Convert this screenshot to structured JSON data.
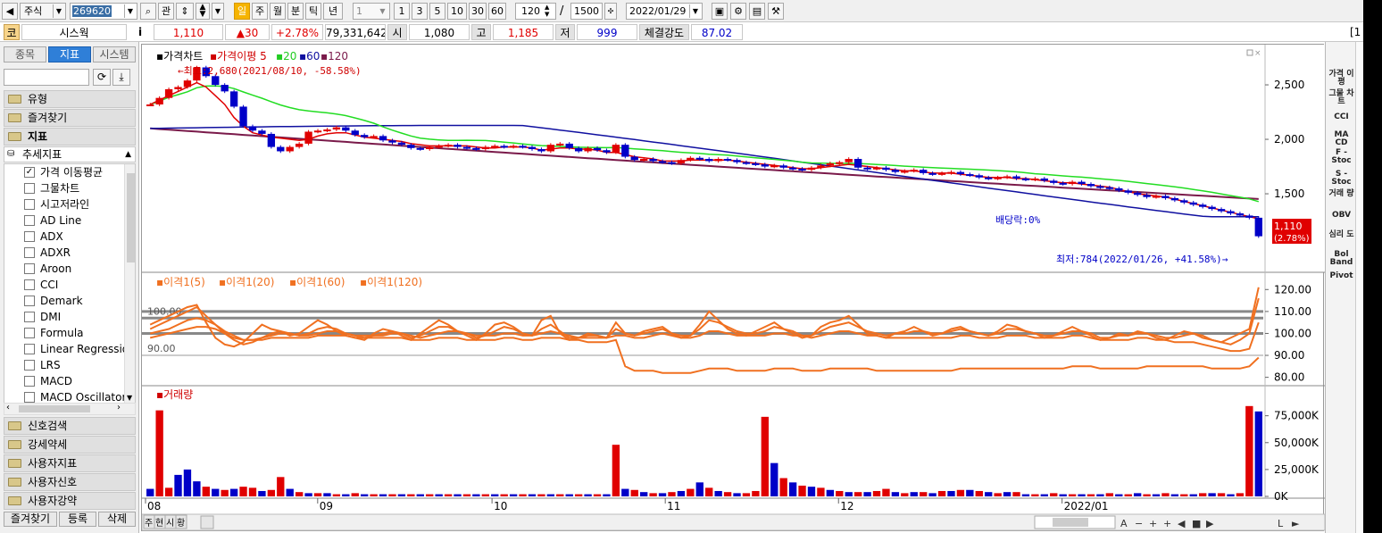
{
  "toolbar": {
    "market": "주식",
    "code": "269620",
    "btn_related": "관",
    "periods": [
      "일",
      "주",
      "월",
      "분",
      "틱",
      "년"
    ],
    "interval_value": "1",
    "intervals": [
      "1",
      "3",
      "5",
      "10",
      "30",
      "60"
    ],
    "view_count": "120",
    "slash": "/",
    "total_count": "1500",
    "date": "2022/01/29"
  },
  "quote": {
    "mark": "코",
    "name": "시스웍",
    "info": "i",
    "price": "1,110",
    "change": "▲30",
    "rate": "+2.78%",
    "volume": "79,331,642",
    "open_label": "시",
    "open": "1,080",
    "high_label": "고",
    "high": "1,185",
    "low_label": "저",
    "low": "999",
    "strength_label": "체결강도",
    "strength": "87.02",
    "edge": "[1"
  },
  "sidebar": {
    "tabs": [
      "종목",
      "지표",
      "시스템"
    ],
    "groups_top": [
      "유형",
      "즐겨찾기",
      "지표"
    ],
    "tree_group": "추세지표",
    "items": [
      {
        "label": "가격 이동평균",
        "checked": true
      },
      {
        "label": "그물차트",
        "checked": false
      },
      {
        "label": "시고저라인",
        "checked": false
      },
      {
        "label": "AD Line",
        "checked": false
      },
      {
        "label": "ADX",
        "checked": false
      },
      {
        "label": "ADXR",
        "checked": false
      },
      {
        "label": "Aroon",
        "checked": false
      },
      {
        "label": "CCI",
        "checked": false
      },
      {
        "label": "Demark",
        "checked": false
      },
      {
        "label": "DMI",
        "checked": false
      },
      {
        "label": "Formula",
        "checked": false
      },
      {
        "label": "Linear Regression",
        "checked": false
      },
      {
        "label": "LRS",
        "checked": false
      },
      {
        "label": "MACD",
        "checked": false
      },
      {
        "label": "MACD Oscillator",
        "checked": false
      }
    ],
    "groups_bottom": [
      "신호검색",
      "강세약세",
      "사용자지표",
      "사용자신호",
      "사용자강약"
    ],
    "bottom_buttons": [
      "즐겨찾기",
      "등록",
      "삭제"
    ]
  },
  "chart_data": [
    {
      "type": "candlestick",
      "legend": [
        "가격차트",
        "가격이평",
        "5",
        "20",
        "60",
        "120"
      ],
      "colors": {
        "up": "#e00000",
        "down": "#0000c8",
        "ma5": "#e00000",
        "ma20": "#22dd22",
        "ma60": "#1010a0",
        "ma120": "#7a1a4a"
      },
      "y_ticks": [
        "2,500",
        "2,000",
        "1,500"
      ],
      "ylim": [
        820,
        2820
      ],
      "annotations": {
        "high": "←최고:2,680(2021/08/10, -58.58%)",
        "low": "최저:784(2022/01/26, +41.58%)→",
        "dividend": "배당락:0%",
        "last_price": "1,110",
        "last_rate": "(2.78%)"
      },
      "open_price": 2320,
      "closes": [
        2320,
        2380,
        2460,
        2480,
        2540,
        2660,
        2580,
        2500,
        2440,
        2300,
        2120,
        2080,
        2050,
        1930,
        1890,
        1930,
        1960,
        2070,
        2080,
        2090,
        2110,
        2080,
        2040,
        2020,
        2030,
        1990,
        1970,
        1950,
        1920,
        1910,
        1930,
        1940,
        1950,
        1930,
        1920,
        1910,
        1930,
        1940,
        1930,
        1940,
        1930,
        1910,
        1890,
        1950,
        1960,
        1920,
        1890,
        1920,
        1900,
        1880,
        1950,
        1840,
        1810,
        1820,
        1800,
        1790,
        1780,
        1810,
        1830,
        1820,
        1800,
        1820,
        1810,
        1790,
        1780,
        1770,
        1750,
        1760,
        1740,
        1730,
        1720,
        1740,
        1760,
        1780,
        1790,
        1820,
        1740,
        1730,
        1740,
        1720,
        1700,
        1710,
        1720,
        1690,
        1680,
        1690,
        1700,
        1680,
        1670,
        1650,
        1640,
        1650,
        1660,
        1640,
        1630,
        1640,
        1620,
        1600,
        1590,
        1610,
        1590,
        1570,
        1560,
        1550,
        1530,
        1510,
        1490,
        1470,
        1480,
        1460,
        1440,
        1420,
        1400,
        1380,
        1360,
        1340,
        1320,
        1300,
        1280,
        1110
      ],
      "ma5": [
        2320,
        2360,
        2400,
        2440,
        2480,
        2520,
        2480,
        2400,
        2320,
        2200,
        2120,
        2060,
        2040,
        2020,
        2010,
        2000,
        1990,
        2000,
        2030,
        2050,
        2060,
        2060,
        2040,
        2020,
        2010,
        2000,
        1990,
        1980,
        1960,
        1950,
        1940,
        1940,
        1940,
        1940,
        1940,
        1930,
        1920,
        1920,
        1930,
        1930,
        1930,
        1920,
        1900,
        1910,
        1920,
        1920,
        1910,
        1910,
        1900,
        1880,
        1880,
        1860,
        1840,
        1830,
        1820,
        1800,
        1800,
        1800,
        1810,
        1810,
        1810,
        1810,
        1810,
        1800,
        1790,
        1780,
        1770,
        1760,
        1750,
        1740,
        1730,
        1730,
        1740,
        1750,
        1760,
        1770,
        1760,
        1750,
        1740,
        1730,
        1720,
        1710,
        1710,
        1700,
        1690,
        1690,
        1690,
        1680,
        1670,
        1660,
        1650,
        1650,
        1650,
        1640,
        1640,
        1630,
        1620,
        1610,
        1600,
        1600,
        1590,
        1580,
        1570,
        1560,
        1540,
        1520,
        1500,
        1490,
        1480,
        1470,
        1450,
        1430,
        1410,
        1390,
        1370,
        1350,
        1330,
        1310,
        1290,
        1270
      ]
    },
    {
      "type": "line",
      "legend": [
        "이격1(5)",
        "이격1(20)",
        "이격1(60)",
        "이격1(120)"
      ],
      "color": "#f07020",
      "y_ticks": [
        "120.00",
        "110.00",
        "100.00",
        "90.00",
        "80.00"
      ],
      "ref_labels": [
        "100.00",
        "90.00"
      ],
      "ylim": [
        77,
        125
      ],
      "series": [
        {
          "name": "이격1(5)",
          "values": [
            104,
            106,
            108,
            110,
            112,
            113,
            105,
            98,
            95,
            94,
            96,
            100,
            104,
            102,
            101,
            99,
            100,
            103,
            106,
            104,
            101,
            99,
            98,
            97,
            100,
            102,
            101,
            99,
            97,
            100,
            103,
            106,
            104,
            101,
            99,
            97,
            100,
            104,
            105,
            103,
            100,
            99,
            106,
            108,
            100,
            97,
            98,
            100,
            99,
            98,
            105,
            100,
            99,
            101,
            102,
            103,
            100,
            98,
            99,
            104,
            110,
            106,
            102,
            100,
            99,
            101,
            103,
            105,
            102,
            100,
            98,
            99,
            103,
            105,
            106,
            108,
            104,
            100,
            99,
            98,
            100,
            101,
            103,
            101,
            99,
            100,
            102,
            103,
            101,
            100,
            99,
            101,
            104,
            103,
            101,
            100,
            98,
            99,
            101,
            103,
            101,
            99,
            97,
            98,
            100,
            99,
            101,
            100,
            98,
            97,
            99,
            101,
            100,
            98,
            97,
            96,
            98,
            100,
            102,
            121
          ]
        },
        {
          "name": "이격1(20)",
          "values": [
            102,
            104,
            106,
            108,
            110,
            112,
            108,
            104,
            100,
            97,
            95,
            96,
            98,
            100,
            101,
            100,
            99,
            100,
            102,
            103,
            102,
            100,
            99,
            98,
            99,
            100,
            101,
            100,
            98,
            99,
            101,
            103,
            103,
            101,
            100,
            98,
            99,
            101,
            103,
            102,
            100,
            99,
            102,
            104,
            101,
            98,
            98,
            99,
            99,
            98,
            102,
            100,
            99,
            100,
            101,
            102,
            100,
            99,
            99,
            102,
            106,
            105,
            103,
            101,
            100,
            100,
            101,
            103,
            102,
            101,
            99,
            99,
            101,
            103,
            104,
            105,
            103,
            101,
            100,
            99,
            100,
            100,
            101,
            101,
            100,
            100,
            101,
            102,
            101,
            100,
            99,
            100,
            102,
            102,
            101,
            100,
            99,
            99,
            100,
            101,
            101,
            100,
            98,
            98,
            99,
            99,
            100,
            100,
            99,
            98,
            98,
            99,
            100,
            99,
            97,
            96,
            95,
            97,
            100,
            116
          ]
        },
        {
          "name": "이격1(60)",
          "values": [
            100,
            101,
            102,
            104,
            106,
            107,
            106,
            104,
            101,
            99,
            97,
            97,
            98,
            99,
            100,
            100,
            99,
            99,
            100,
            101,
            101,
            100,
            99,
            99,
            99,
            99,
            100,
            100,
            99,
            98,
            99,
            100,
            101,
            101,
            100,
            99,
            99,
            99,
            100,
            100,
            99,
            99,
            100,
            101,
            100,
            99,
            98,
            98,
            98,
            98,
            99,
            99,
            98,
            98,
            99,
            100,
            99,
            98,
            98,
            99,
            101,
            101,
            100,
            99,
            99,
            99,
            99,
            100,
            100,
            99,
            99,
            98,
            99,
            100,
            101,
            101,
            100,
            99,
            99,
            98,
            98,
            98,
            98,
            98,
            98,
            98,
            98,
            99,
            99,
            98,
            98,
            98,
            99,
            99,
            99,
            98,
            98,
            98,
            98,
            99,
            99,
            98,
            97,
            97,
            97,
            97,
            98,
            98,
            97,
            97,
            96,
            96,
            96,
            95,
            94,
            93,
            92,
            92,
            93,
            105
          ]
        },
        {
          "name": "이격1(120)",
          "values": [
            98,
            99,
            100,
            101,
            102,
            103,
            103,
            102,
            100,
            98,
            97,
            97,
            97,
            98,
            98,
            98,
            98,
            98,
            99,
            99,
            99,
            99,
            98,
            98,
            98,
            98,
            98,
            98,
            97,
            97,
            97,
            98,
            98,
            98,
            97,
            97,
            97,
            97,
            98,
            98,
            97,
            97,
            98,
            98,
            98,
            97,
            97,
            96,
            96,
            96,
            97,
            85,
            83,
            83,
            83,
            82,
            82,
            82,
            82,
            83,
            84,
            84,
            84,
            83,
            83,
            83,
            83,
            84,
            84,
            84,
            83,
            83,
            83,
            84,
            84,
            84,
            84,
            84,
            83,
            83,
            83,
            83,
            83,
            83,
            83,
            83,
            83,
            84,
            84,
            84,
            84,
            84,
            84,
            84,
            84,
            84,
            84,
            84,
            84,
            85,
            85,
            85,
            84,
            84,
            84,
            84,
            84,
            85,
            85,
            85,
            85,
            85,
            85,
            85,
            84,
            84,
            84,
            84,
            85,
            89
          ]
        }
      ]
    },
    {
      "type": "bar",
      "legend": [
        "거래량"
      ],
      "y_ticks": [
        "75,000K",
        "50,000K",
        "25,000K",
        "0K"
      ],
      "ylim": [
        0,
        88000
      ],
      "x_labels": [
        "08",
        "09",
        "10",
        "11",
        "12",
        "2022/01"
      ],
      "colors": {
        "up": "#e00000",
        "down": "#0000c8"
      },
      "values": [
        7000,
        80000,
        8000,
        20000,
        25000,
        14000,
        9000,
        7000,
        6000,
        7000,
        9000,
        8000,
        5000,
        6000,
        18000,
        7000,
        4000,
        3000,
        3000,
        3000,
        2000,
        2000,
        3000,
        2000,
        2000,
        2000,
        2000,
        2000,
        2000,
        2000,
        2000,
        2000,
        2000,
        2000,
        2000,
        2000,
        2000,
        2000,
        2000,
        2000,
        2000,
        2000,
        2000,
        2000,
        2000,
        2000,
        2000,
        2000,
        2000,
        2000,
        48000,
        7000,
        6000,
        4000,
        3000,
        3000,
        4000,
        5000,
        7000,
        13000,
        8000,
        5000,
        4000,
        3000,
        3000,
        5000,
        74000,
        31000,
        17000,
        13000,
        10000,
        9000,
        8000,
        6000,
        5000,
        4000,
        4000,
        4000,
        5000,
        7000,
        4000,
        3000,
        4000,
        4000,
        3000,
        5000,
        5000,
        6000,
        6000,
        5000,
        4000,
        3000,
        4000,
        4000,
        2000,
        2000,
        2000,
        3000,
        2000,
        2000,
        2000,
        2000,
        2000,
        3000,
        2000,
        2000,
        3000,
        2000,
        2000,
        3000,
        2000,
        2000,
        2000,
        3000,
        3000,
        3000,
        2000,
        3000,
        84000,
        79000
      ],
      "up": [
        false,
        true,
        true,
        false,
        false,
        false,
        true,
        false,
        true,
        false,
        true,
        true,
        false,
        true,
        true,
        false,
        true,
        false,
        true,
        false,
        true,
        false,
        true,
        false,
        true,
        false,
        true,
        false,
        true,
        false,
        true,
        false,
        true,
        false,
        true,
        false,
        true,
        false,
        true,
        false,
        true,
        false,
        true,
        false,
        true,
        false,
        true,
        false,
        true,
        false,
        true,
        false,
        true,
        false,
        true,
        false,
        true,
        false,
        true,
        false,
        true,
        false,
        true,
        false,
        true,
        true,
        true,
        false,
        true,
        false,
        true,
        false,
        true,
        false,
        true,
        false,
        true,
        false,
        true,
        true,
        false,
        true,
        false,
        true,
        false,
        true,
        false,
        true,
        false,
        true,
        false,
        true,
        false,
        true,
        false,
        true,
        false,
        true,
        false,
        true,
        false,
        true,
        false,
        true,
        false,
        true,
        false,
        true,
        false,
        true,
        false,
        true,
        false,
        true,
        false,
        true,
        false,
        true,
        true,
        false
      ]
    }
  ],
  "right_panel": [
    "가격 이평",
    "그물 차트",
    "CCI",
    "MA CD",
    "F - Stoc",
    "S - Stoc",
    "거래 량",
    "OBV",
    "심리 도",
    "Bol Band",
    "Pivot"
  ],
  "bottom": {
    "left_tabs": [
      "주",
      "현",
      "시",
      "황"
    ]
  }
}
